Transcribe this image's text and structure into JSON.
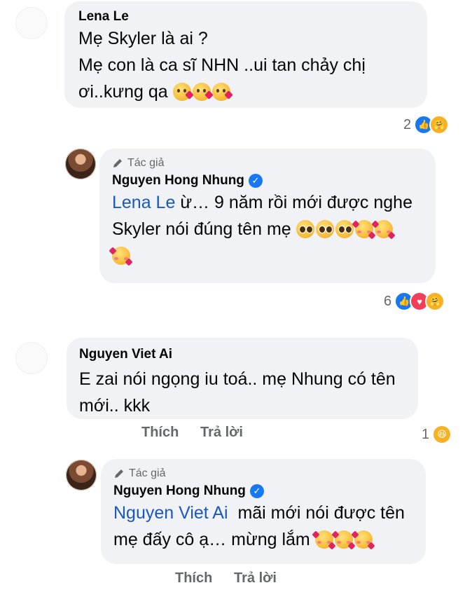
{
  "comments": [
    {
      "author": "Lena Le",
      "lines": [
        "Mẹ Skyler là ai ?",
        "Mẹ con là ca sĩ NHN ..ui tan chảy chị",
        "ơi..kưng qa"
      ],
      "reaction_count": "2",
      "reaction_icons": [
        "like-icon",
        "care-icon"
      ]
    },
    {
      "badge": "Tác giả",
      "author": "Nguyen Hong Nhung",
      "mention": "Lena Le",
      "line1_rest": " ừ… 9 năm rồi mới được nghe",
      "line2": "Skyler nói đúng tên mẹ",
      "reaction_count": "6",
      "reaction_icons": [
        "like-icon",
        "love-icon",
        "care-icon"
      ]
    },
    {
      "author": "Nguyen Viet Ai",
      "lines": [
        "E zai nói ngọng iu toá.. mẹ Nhung có tên",
        "mới.. kkk"
      ],
      "like_label": "Thích",
      "reply_label": "Trả lời",
      "reaction_count": "1",
      "reaction_icons": [
        "haha-icon"
      ]
    },
    {
      "badge": "Tác giả",
      "author": "Nguyen Hong Nhung",
      "mention": "Nguyen Viet Ai",
      "line1_rest": "  mãi mới nói được tên",
      "line2": "mẹ đấy cô ạ… mừng lắm",
      "like_label": "Thích",
      "reply_label": "Trả lời"
    }
  ]
}
